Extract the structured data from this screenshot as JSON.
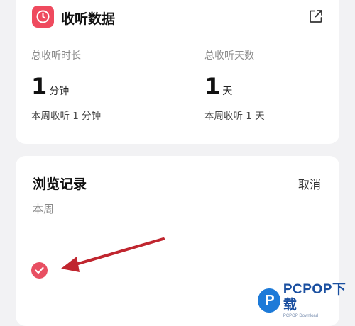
{
  "stats_card": {
    "title": "收听数据",
    "total_duration": {
      "label": "总收听时长",
      "value": "1",
      "unit": "分钟",
      "weekly": "本周收听 1 分钟"
    },
    "total_days": {
      "label": "总收听天数",
      "value": "1",
      "unit": "天",
      "weekly": "本周收听 1 天"
    }
  },
  "history_card": {
    "title": "浏览记录",
    "cancel_label": "取消",
    "period_label": "本周"
  },
  "watermark": {
    "logo_letter": "P",
    "brand": "PCPOP下载",
    "sub": "PCPOP Download"
  },
  "colors": {
    "accent": "#ef4a5e",
    "check": "#e84f62",
    "arrow": "#c0262f",
    "background": "#f2f2f4"
  }
}
